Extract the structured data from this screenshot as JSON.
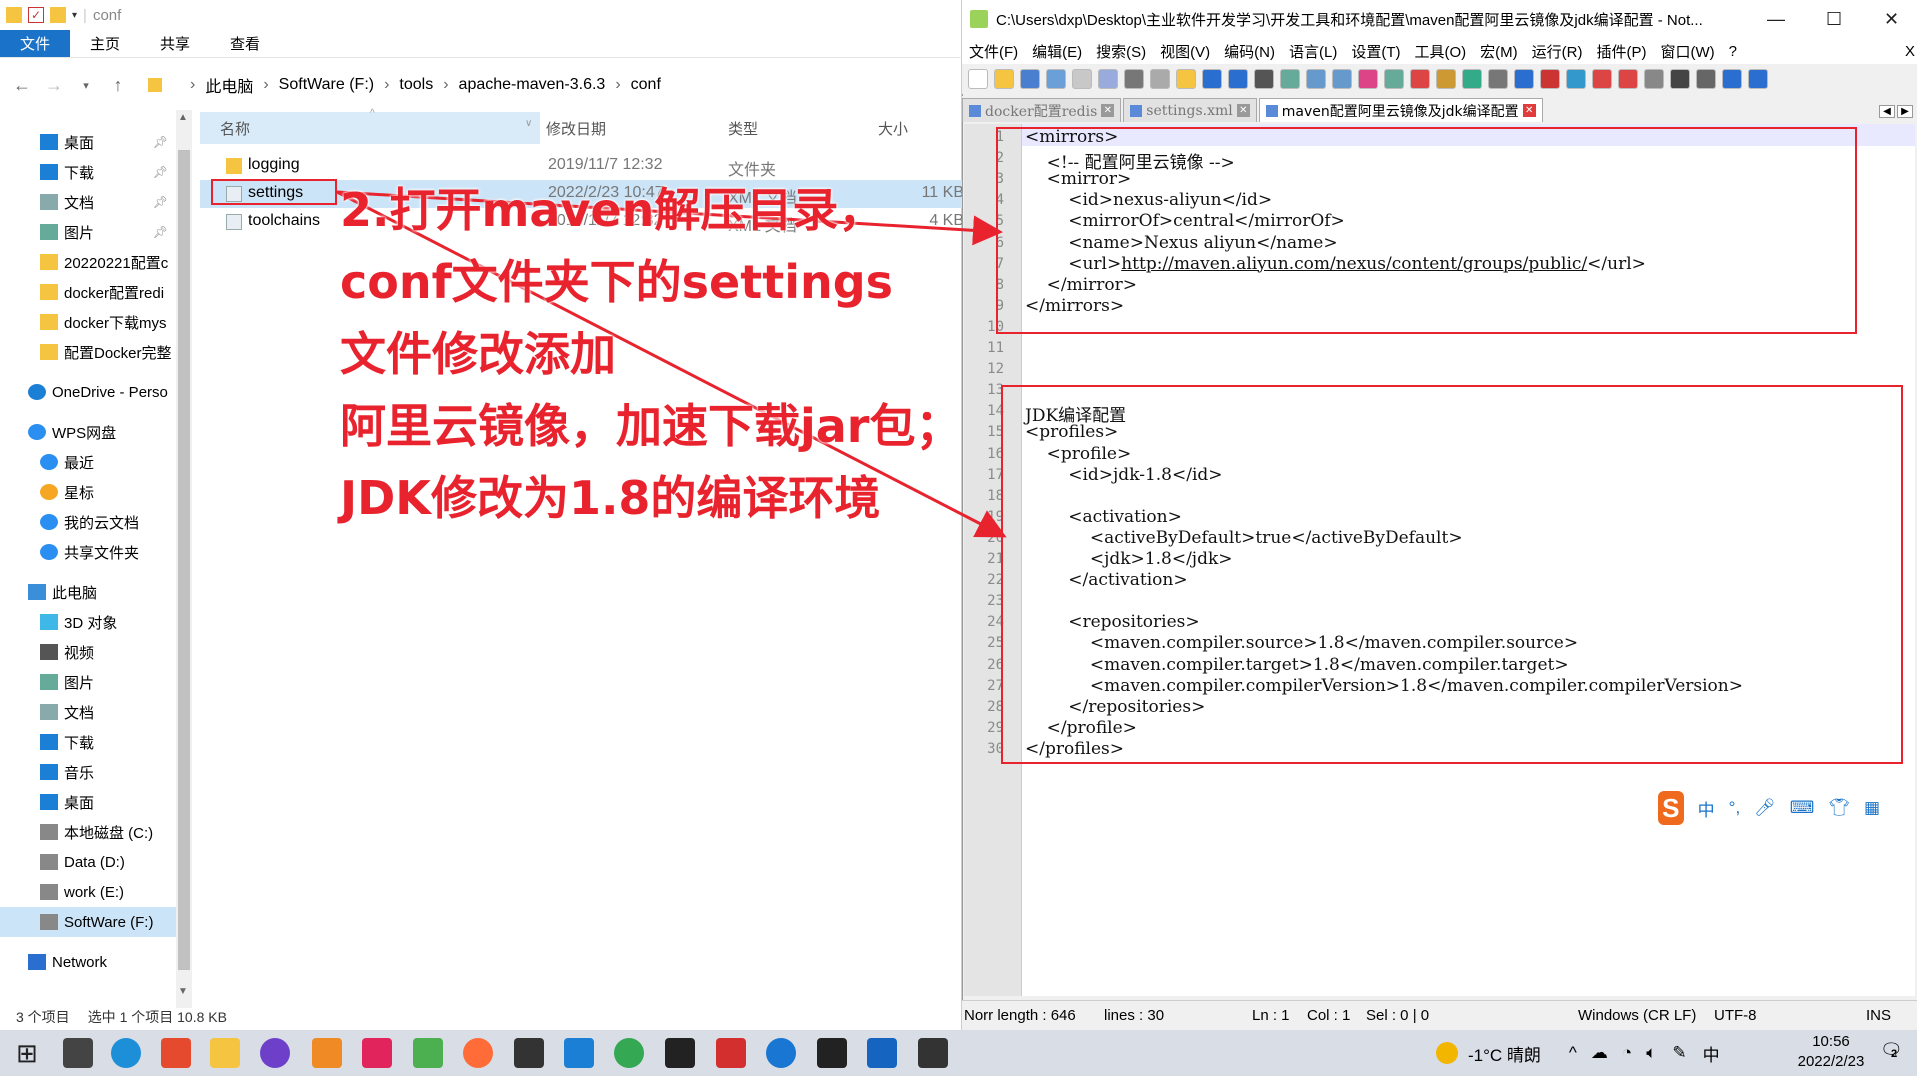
{
  "explorer": {
    "title": "conf",
    "ribbon_tabs": [
      "文件",
      "主页",
      "共享",
      "查看"
    ],
    "breadcrumb": [
      "此电脑",
      "SoftWare (F:)",
      "tools",
      "apache-maven-3.6.3",
      "conf"
    ],
    "nav_items": [
      {
        "label": "桌面",
        "pinned": true,
        "icon": "desktop-icon"
      },
      {
        "label": "下载",
        "pinned": true,
        "icon": "download-icon"
      },
      {
        "label": "文档",
        "pinned": true,
        "icon": "document-icon"
      },
      {
        "label": "图片",
        "pinned": true,
        "icon": "picture-icon"
      },
      {
        "label": "20220221配置c",
        "icon": "folder-icon"
      },
      {
        "label": "docker配置redi",
        "icon": "folder-icon"
      },
      {
        "label": "docker下载mys",
        "icon": "folder-icon"
      },
      {
        "label": "配置Docker完整",
        "icon": "folder-icon"
      },
      {
        "label": "OneDrive - Perso",
        "icon": "onedrive-icon"
      },
      {
        "label": "WPS网盘",
        "icon": "cloud-icon"
      },
      {
        "label": "最近",
        "icon": "clock-icon"
      },
      {
        "label": "星标",
        "icon": "star-icon"
      },
      {
        "label": "我的云文档",
        "icon": "cloud-icon"
      },
      {
        "label": "共享文件夹",
        "icon": "share-icon"
      },
      {
        "label": "此电脑",
        "icon": "computer-icon"
      },
      {
        "label": "3D 对象",
        "icon": "cube-icon"
      },
      {
        "label": "视频",
        "icon": "video-icon"
      },
      {
        "label": "图片",
        "icon": "picture-icon"
      },
      {
        "label": "文档",
        "icon": "document-icon"
      },
      {
        "label": "下载",
        "icon": "download-icon"
      },
      {
        "label": "音乐",
        "icon": "music-icon"
      },
      {
        "label": "桌面",
        "icon": "desktop-icon"
      },
      {
        "label": "本地磁盘 (C:)",
        "icon": "drive-icon"
      },
      {
        "label": "Data (D:)",
        "icon": "drive-icon"
      },
      {
        "label": "work (E:)",
        "icon": "drive-icon"
      },
      {
        "label": "SoftWare (F:)",
        "icon": "drive-icon",
        "selected": true
      },
      {
        "label": "Network",
        "icon": "network-icon"
      }
    ],
    "columns": {
      "name": "名称",
      "date": "修改日期",
      "type": "类型",
      "size": "大小"
    },
    "files": [
      {
        "name": "logging",
        "date": "2019/11/7 12:32",
        "type": "文件夹",
        "size": "",
        "icon": "folder-icon"
      },
      {
        "name": "settings",
        "date": "2022/2/23 10:47",
        "type": "XML 文档",
        "size": "11 KB",
        "icon": "xml-file-icon",
        "selected": true
      },
      {
        "name": "toolchains",
        "date": "2019/11/7 12:32",
        "type": "XML 文档",
        "size": "4 KB",
        "icon": "xml-file-icon"
      }
    ],
    "status": {
      "count": "3 个项目",
      "selection": "选中 1 个项目  10.8 KB"
    }
  },
  "annotation": {
    "lines": [
      "2.打开maven解压目录，",
      "conf文件夹下的settings",
      "文件修改添加",
      "阿里云镜像，加速下载jar包；",
      "JDK修改为1.8的编译环境"
    ],
    "color": "#e8232e"
  },
  "npp": {
    "title": "C:\\Users\\dxp\\Desktop\\主业软件开发学习\\开发工具和环境配置\\maven配置阿里云镜像及jdk编译配置 - Not...",
    "menu": [
      "文件(F)",
      "编辑(E)",
      "搜索(S)",
      "视图(V)",
      "编码(N)",
      "语言(L)",
      "设置(T)",
      "工具(O)",
      "宏(M)",
      "运行(R)",
      "插件(P)",
      "窗口(W)",
      "?"
    ],
    "close_label": "X",
    "tabs": [
      {
        "label": "docker配置redis"
      },
      {
        "label": "settings.xml"
      },
      {
        "label": "maven配置阿里云镜像及jdk编译配置",
        "active": true
      }
    ],
    "lines": [
      "<mirrors>",
      "    <!-- 配置阿里云镜像 -->",
      "    <mirror>",
      "        <id>nexus-aliyun</id>",
      "        <mirrorOf>central</mirrorOf>",
      "        <name>Nexus aliyun</name>",
      "        <url>http://maven.aliyun.com/nexus/content/groups/public/</url>",
      "    </mirror>",
      "</mirrors>",
      "",
      "",
      "",
      "",
      "JDK编译配置",
      "<profiles>",
      "    <profile>",
      "        <id>jdk-1.8</id>",
      "",
      "        <activation>",
      "            <activeByDefault>true</activeByDefault>",
      "            <jdk>1.8</jdk>",
      "        </activation>",
      "",
      "        <repositories>",
      "            <maven.compiler.source>1.8</maven.compiler.source>",
      "            <maven.compiler.target>1.8</maven.compiler.target>",
      "            <maven.compiler.compilerVersion>1.8</maven.compiler.compilerVersion>",
      "        </repositories>",
      "    </profile>",
      "</profiles>"
    ],
    "line_numbers": [
      "1",
      "2",
      "3",
      "4",
      "5",
      "6",
      "7",
      "8",
      "9",
      "10",
      "11",
      "12",
      "13",
      "14",
      "15",
      "16",
      "17",
      "18",
      "19",
      "20",
      "21",
      "22",
      "23",
      "24",
      "25",
      "26",
      "27",
      "28",
      "29",
      "30"
    ],
    "status": {
      "length": "Norr length : 646",
      "lines": "lines : 30",
      "ln": "Ln : 1",
      "col": "Col : 1",
      "sel": "Sel : 0 | 0",
      "eol": "Windows (CR LF)",
      "enc": "UTF-8",
      "mode": "INS"
    },
    "ime": {
      "logo": "S",
      "lang": "中",
      "punct": "°,"
    }
  },
  "taskbar": {
    "apps": [
      "start-icon",
      "task-view-icon",
      "edge-icon",
      "app-store-icon",
      "file-explorer-icon",
      "github-icon",
      "photo-icon",
      "intellij-icon",
      "notepadpp-icon",
      "postman-icon",
      "remote-icon",
      "webstorm-icon",
      "chrome-icon",
      "typora-icon",
      "wps-icon",
      "kugou-icon",
      "qq-icon",
      "virtualbox-icon",
      "terminal-icon"
    ],
    "weather": "-1°C  晴朗",
    "ime": "中",
    "time": "10:56",
    "date": "2022/2/23",
    "notifications": "2"
  }
}
